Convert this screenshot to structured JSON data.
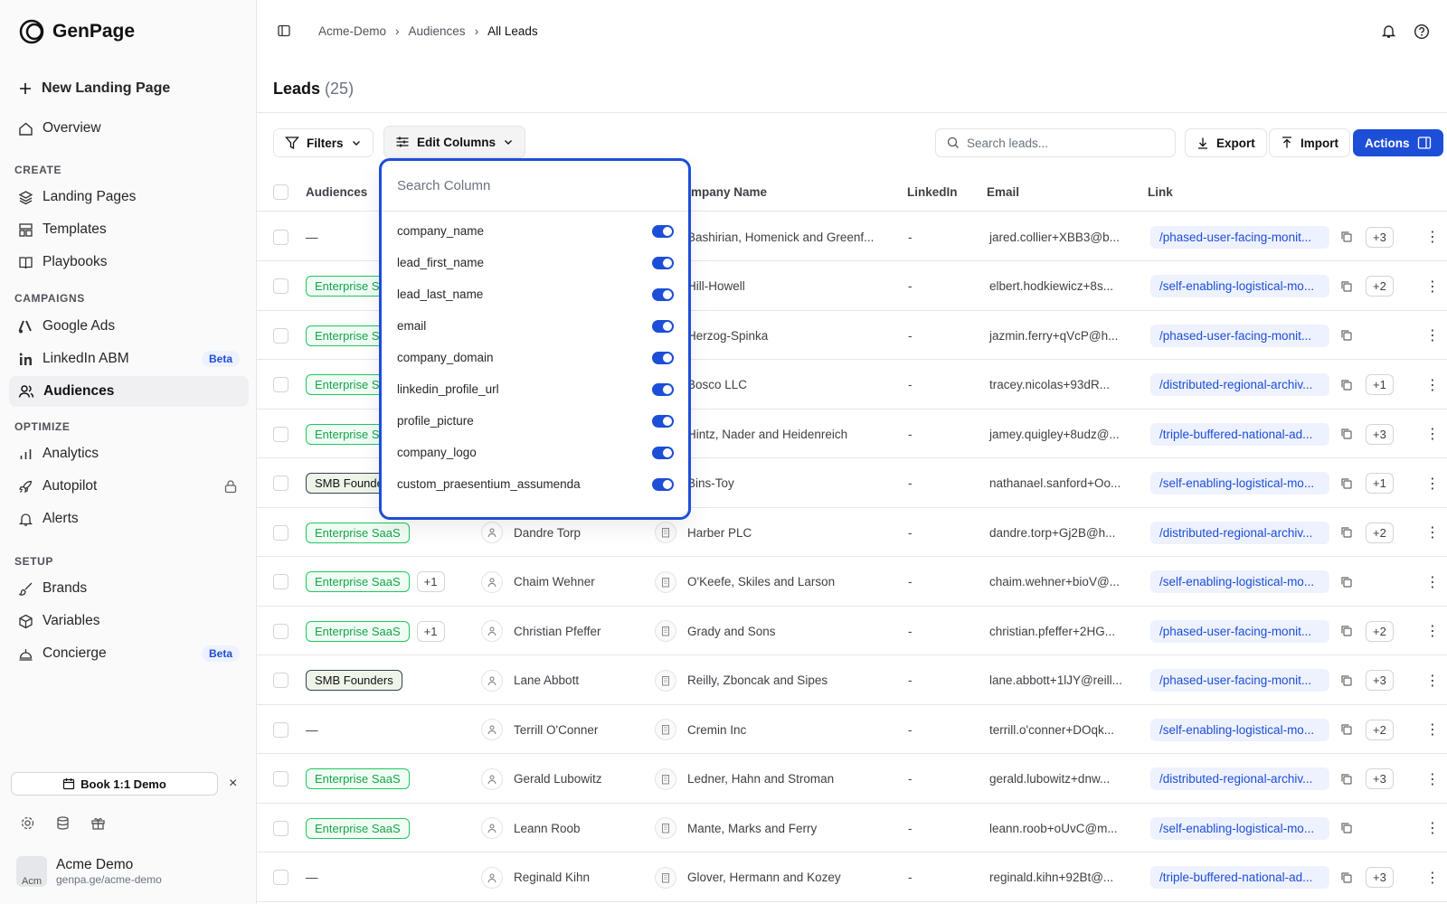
{
  "brand": {
    "name": "GenPage"
  },
  "sidebar": {
    "new_page": "New Landing Page",
    "overview": "Overview",
    "sections": {
      "create": "CREATE",
      "campaigns": "CAMPAIGNS",
      "optimize": "OPTIMIZE",
      "setup": "SETUP"
    },
    "items": {
      "landing_pages": "Landing Pages",
      "templates": "Templates",
      "playbooks": "Playbooks",
      "google_ads": "Google Ads",
      "linkedin_abm": "LinkedIn ABM",
      "audiences": "Audiences",
      "analytics": "Analytics",
      "autopilot": "Autopilot",
      "alerts": "Alerts",
      "brands": "Brands",
      "variables": "Variables",
      "concierge": "Concierge"
    },
    "beta": "Beta",
    "demo_button": "Book 1:1 Demo",
    "close": "×",
    "account": {
      "name": "Acme Demo",
      "url": "genpa.ge/acme-demo",
      "avatar_alt": "Acm"
    }
  },
  "breadcrumb": [
    "Acme-Demo",
    "Audiences",
    "All Leads"
  ],
  "page": {
    "title": "Leads",
    "count": "(25)"
  },
  "toolbar": {
    "filters": "Filters",
    "edit_columns": "Edit Columns",
    "search_placeholder": "Search leads...",
    "export": "Export",
    "import": "Import",
    "actions": "Actions"
  },
  "table": {
    "headers": {
      "audiences": "Audiences",
      "company": "Company Name",
      "linkedin": "LinkedIn",
      "email": "Email",
      "link": "Link"
    },
    "rows": [
      {
        "audience": "",
        "audience_type": "none",
        "extra": "",
        "name": "",
        "company": "Bashirian, Homenick and Greenf...",
        "linkedin": "-",
        "email": "jared.collier+XBB3@b...",
        "link": "/phased-user-facing-monit...",
        "more": "+3"
      },
      {
        "audience": "Enterprise SaaS",
        "audience_type": "ent",
        "extra": "",
        "name": "",
        "company": "Hill-Howell",
        "linkedin": "-",
        "email": "elbert.hodkiewicz+8s...",
        "link": "/self-enabling-logistical-mo...",
        "more": "+2"
      },
      {
        "audience": "Enterprise SaaS",
        "audience_type": "ent",
        "extra": "",
        "name": "",
        "company": "Herzog-Spinka",
        "linkedin": "-",
        "email": "jazmin.ferry+qVcP@h...",
        "link": "/phased-user-facing-monit...",
        "more": ""
      },
      {
        "audience": "Enterprise SaaS",
        "audience_type": "ent",
        "extra": "",
        "name": "",
        "company": "Bosco LLC",
        "linkedin": "-",
        "email": "tracey.nicolas+93dR...",
        "link": "/distributed-regional-archiv...",
        "more": "+1"
      },
      {
        "audience": "Enterprise SaaS",
        "audience_type": "ent",
        "extra": "",
        "name": "",
        "company": "Hintz, Nader and Heidenreich",
        "linkedin": "-",
        "email": "jamey.quigley+8udz@...",
        "link": "/triple-buffered-national-ad...",
        "more": "+3"
      },
      {
        "audience": "SMB Founders",
        "audience_type": "smb",
        "extra": "",
        "name": "",
        "company": "Bins-Toy",
        "linkedin": "-",
        "email": "nathanael.sanford+Oo...",
        "link": "/self-enabling-logistical-mo...",
        "more": "+1"
      },
      {
        "audience": "Enterprise SaaS",
        "audience_type": "ent",
        "extra": "",
        "name": "Dandre Torp",
        "company": "Harber PLC",
        "linkedin": "-",
        "email": "dandre.torp+Gj2B@h...",
        "link": "/distributed-regional-archiv...",
        "more": "+2"
      },
      {
        "audience": "Enterprise SaaS",
        "audience_type": "ent",
        "extra": "+1",
        "name": "Chaim Wehner",
        "company": "O'Keefe, Skiles and Larson",
        "linkedin": "-",
        "email": "chaim.wehner+bioV@...",
        "link": "/self-enabling-logistical-mo...",
        "more": ""
      },
      {
        "audience": "Enterprise SaaS",
        "audience_type": "ent",
        "extra": "+1",
        "name": "Christian Pfeffer",
        "company": "Grady and Sons",
        "linkedin": "-",
        "email": "christian.pfeffer+2HG...",
        "link": "/phased-user-facing-monit...",
        "more": "+2"
      },
      {
        "audience": "SMB Founders",
        "audience_type": "smb",
        "extra": "",
        "name": "Lane Abbott",
        "company": "Reilly, Zboncak and Sipes",
        "linkedin": "-",
        "email": "lane.abbott+1lJY@reill...",
        "link": "/phased-user-facing-monit...",
        "more": "+3"
      },
      {
        "audience": "—",
        "audience_type": "none",
        "extra": "",
        "name": "Terrill O'Conner",
        "company": "Cremin Inc",
        "linkedin": "-",
        "email": "terrill.o'conner+DOqk...",
        "link": "/self-enabling-logistical-mo...",
        "more": "+2"
      },
      {
        "audience": "Enterprise SaaS",
        "audience_type": "ent",
        "extra": "",
        "name": "Gerald Lubowitz",
        "company": "Ledner, Hahn and Stroman",
        "linkedin": "-",
        "email": "gerald.lubowitz+dnw...",
        "link": "/distributed-regional-archiv...",
        "more": "+3"
      },
      {
        "audience": "Enterprise SaaS",
        "audience_type": "ent",
        "extra": "",
        "name": "Leann Roob",
        "company": "Mante, Marks and Ferry",
        "linkedin": "-",
        "email": "leann.roob+oUvC@m...",
        "link": "/self-enabling-logistical-mo...",
        "more": ""
      },
      {
        "audience": "—",
        "audience_type": "none",
        "extra": "",
        "name": "Reginald Kihn",
        "company": "Glover, Hermann and Kozey",
        "linkedin": "-",
        "email": "reginald.kihn+92Bt@...",
        "link": "/triple-buffered-national-ad...",
        "more": "+3"
      }
    ]
  },
  "column_menu": {
    "placeholder": "Search Column",
    "columns": [
      "company_name",
      "lead_first_name",
      "lead_last_name",
      "email",
      "company_domain",
      "linkedin_profile_url",
      "profile_picture",
      "company_logo",
      "custom_praesentium_assumenda"
    ]
  },
  "colors": {
    "accent": "#1d4ed8",
    "tag_green": "#16a34a"
  }
}
